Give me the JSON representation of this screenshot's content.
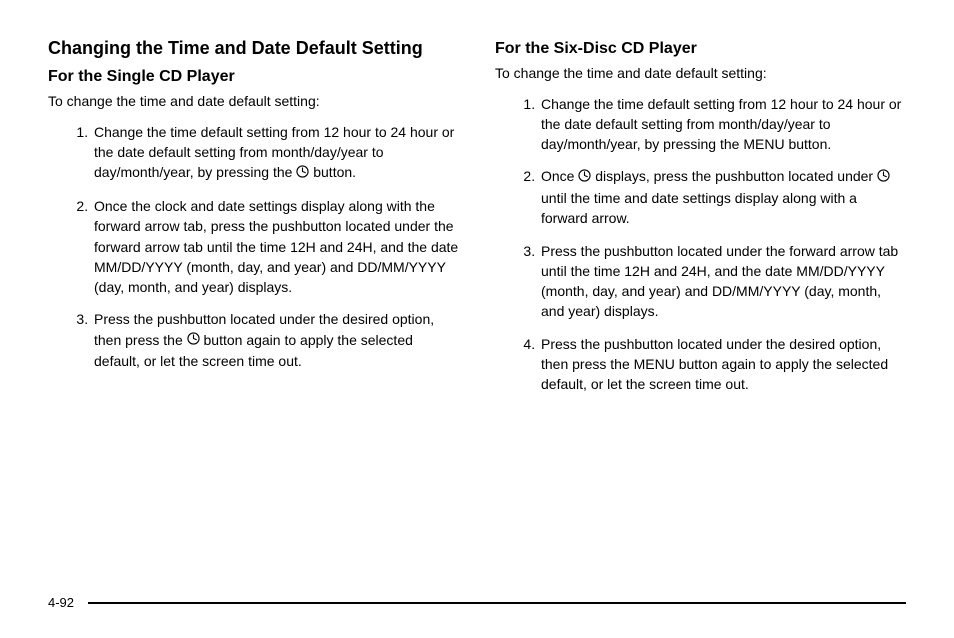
{
  "left": {
    "h2": "Changing the Time and Date Default Setting",
    "h3": "For the Single CD Player",
    "intro": "To change the time and date default setting:",
    "steps": {
      "s1a": "Change the time default setting from 12 hour to 24 hour or the date default setting from month/day/year to day/month/year, by pressing the ",
      "s1b": " button.",
      "s2": "Once the clock and date settings display along with the forward arrow tab, press the pushbutton located under the forward arrow tab until the time 12H and 24H, and the date MM/DD/YYYY (month, day, and year) and DD/MM/YYYY (day, month, and year) displays.",
      "s3a": " Press the pushbutton located under the desired option, then press the ",
      "s3b": " button again to apply the selected default, or let the screen time out."
    }
  },
  "right": {
    "h3": "For the Six-Disc CD Player",
    "intro": "To change the time and date default setting:",
    "steps": {
      "s1": "Change the time default setting from 12 hour to 24 hour or the date default setting from month/day/year to day/month/year, by pressing the MENU button.",
      "s2a": "Once ",
      "s2b": " displays, press the pushbutton located under ",
      "s2c": " until the time and date settings display along with a forward arrow.",
      "s3": "Press the pushbutton located under the forward arrow tab until the time 12H and 24H, and the date MM/DD/YYYY (month, day, and year) and DD/MM/YYYY (day, month, and year) displays.",
      "s4": " Press the pushbutton located under the desired option, then press the MENU button again to apply the selected default, or let the screen time out."
    }
  },
  "page_number": "4-92"
}
